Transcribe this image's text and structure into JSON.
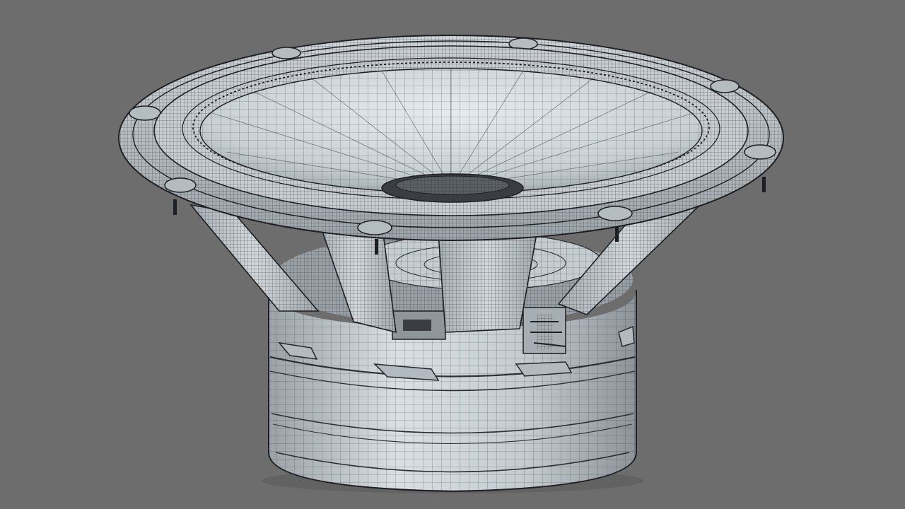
{
  "scene": {
    "subject": "speaker-driver",
    "render_style": "wireframe-on-shaded",
    "colors": {
      "background": "#6d6d6d",
      "surface_light": "#dde3e6",
      "surface_mid": "#b9c0c4",
      "surface_dark": "#8e959a",
      "wire": "#2b2f33",
      "shadow": "#1d1f22"
    }
  }
}
